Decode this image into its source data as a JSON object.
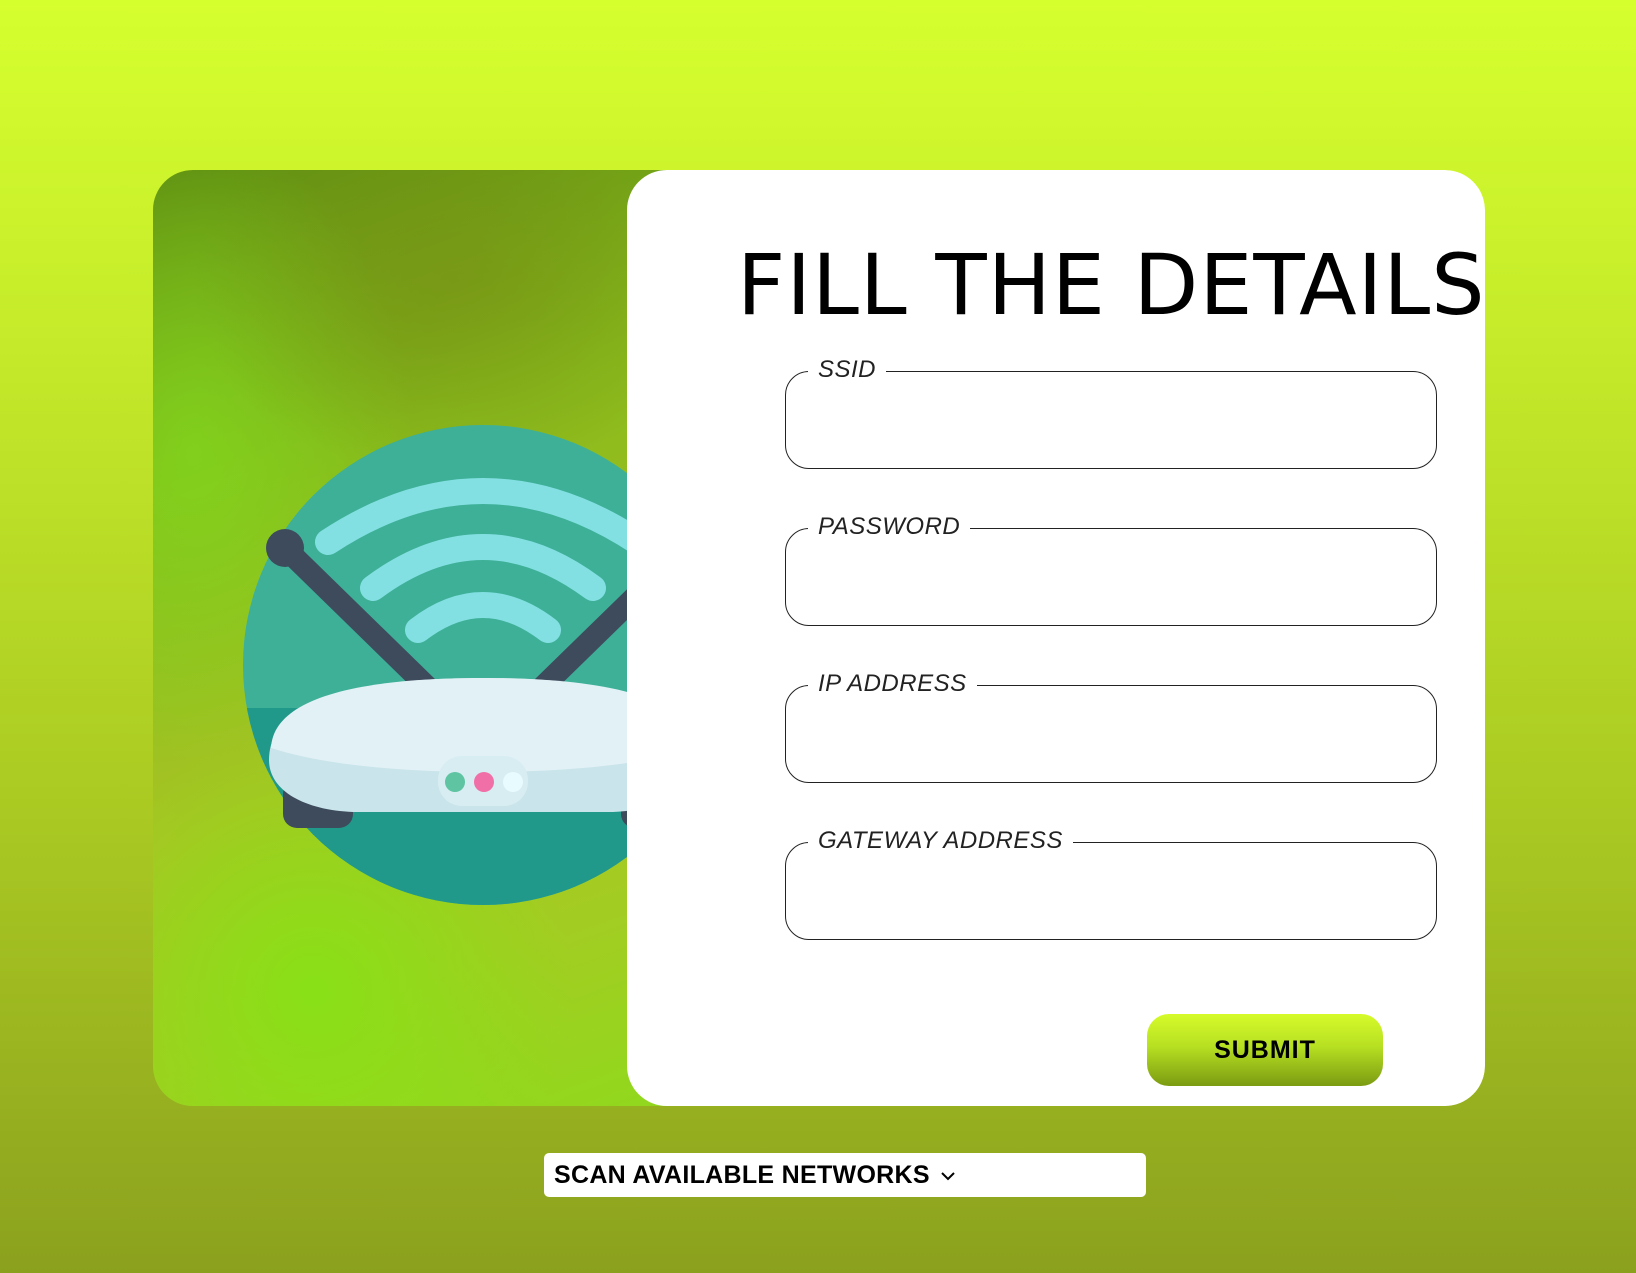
{
  "form": {
    "title": "FILL THE DETAILS",
    "fields": [
      {
        "label": "SSID",
        "value": "",
        "placeholder": ""
      },
      {
        "label": "PASSWORD",
        "value": "",
        "placeholder": ""
      },
      {
        "label": "IP ADDRESS",
        "value": "",
        "placeholder": ""
      },
      {
        "label": "GATEWAY ADDRESS",
        "value": "",
        "placeholder": ""
      }
    ],
    "submit_label": "SUBMIT"
  },
  "scan": {
    "label": "SCAN AVAILABLE NETWORKS",
    "icon": "chevron-down-icon"
  },
  "illustration": {
    "icon": "wifi-router-icon",
    "leds": [
      "#5ec4a2",
      "#f06fa6",
      "#e8fbff"
    ]
  },
  "colors": {
    "background_top": "#d6ff2e",
    "background_bottom": "#8ba11e",
    "panel": "#ffffff",
    "button": "#b7e022",
    "globe": "#3eb098",
    "wifi_waves": "#83e0e2"
  }
}
